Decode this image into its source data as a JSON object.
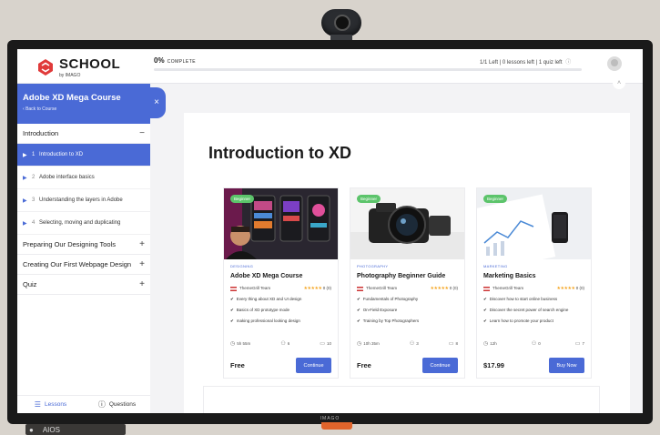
{
  "brand": {
    "name": "SCHOOL",
    "by": "by IMAGO"
  },
  "progress": {
    "percent_value": "0",
    "percent_symbol": "%",
    "label": "COMPLETE",
    "fraction": 0
  },
  "stats": "1/1 Left | 0 lessons left | 1 quiz left",
  "sidebar": {
    "course_title": "Adobe XD Mega Course",
    "back_label": "Back to Course",
    "close_icon": "×",
    "sections": [
      {
        "label": "Introduction",
        "ctrl": "−"
      },
      {
        "label": "Preparing Our Designing Tools",
        "ctrl": "+"
      },
      {
        "label": "Creating Our First Webpage Design",
        "ctrl": "+"
      },
      {
        "label": "Quiz",
        "ctrl": "+"
      }
    ],
    "lessons": [
      {
        "num": "1",
        "label": "Introduction to XD"
      },
      {
        "num": "2",
        "label": "Adobe interface basics"
      },
      {
        "num": "3",
        "label": "Understanding the layers in Adobe"
      },
      {
        "num": "4",
        "label": "Selecting, moving and duplicating"
      }
    ],
    "tabs": [
      {
        "label": "Lessons"
      },
      {
        "label": "Questions"
      }
    ]
  },
  "main": {
    "title": "Introduction to XD"
  },
  "cards": [
    {
      "badge": "Beginner",
      "category": "DESIGNING",
      "title": "Adobe XD Mega Course",
      "author": "ThemeGrill Team",
      "stars": "★★★★★",
      "reviews": "0 (0)",
      "features": [
        "Every thing about XD and UI design",
        "Basics of XD prototype mode",
        "making professional looking design"
      ],
      "duration": "5h 55m",
      "students": "6",
      "lessons": "10",
      "price": "Free",
      "button": "Continue"
    },
    {
      "badge": "Beginner",
      "category": "PHOTOGRAPHY",
      "title": "Photography Beginner Guide",
      "author": "ThemeGrill Team",
      "stars": "★★★★★",
      "reviews": "0 (0)",
      "features": [
        "Fundamentals of Photography",
        "On-Field Exposure",
        "Training by Top Photographers"
      ],
      "duration": "10h 35m",
      "students": "3",
      "lessons": "8",
      "price": "Free",
      "button": "Continue"
    },
    {
      "badge": "Beginner",
      "category": "MARKETING",
      "title": "Marketing Basics",
      "author": "ThemeGrill Team",
      "stars": "★★★★★",
      "reviews": "0 (0)",
      "features": [
        "Discover how to start online business",
        "Discover the secret power of search engine",
        "Learn how to promote your product"
      ],
      "duration": "12h",
      "students": "0",
      "lessons": "7",
      "price": "$17.99",
      "button": "Buy Now"
    }
  ],
  "bezel_brand": "IMAGO",
  "desk_label": "AIOS",
  "colors": {
    "accent": "#4a6ad6",
    "badge": "#5cc46b",
    "stars": "#f5a623",
    "stand": "#e0642b"
  }
}
